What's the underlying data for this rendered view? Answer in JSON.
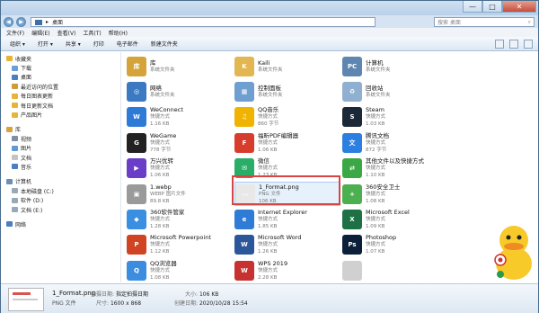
{
  "title": {
    "breadcrumb": "桌面",
    "arrow": "▸"
  },
  "window": {
    "min": "—",
    "max": "□",
    "close": "✕"
  },
  "search": {
    "placeholder": "搜索 桌面"
  },
  "menu": [
    "文件(F)",
    "编辑(E)",
    "查看(V)",
    "工具(T)",
    "帮助(H)"
  ],
  "toolbar": [
    "组织 ▾",
    "打开 ▾",
    "共享 ▾",
    "打印",
    "电子邮件",
    "新建文件夹"
  ],
  "nav": [
    {
      "label": "收藏夹",
      "color": "#e8b339",
      "indent": 6
    },
    {
      "label": "下载",
      "color": "#6aa0d8",
      "indent": 12
    },
    {
      "label": "桌面",
      "color": "#4a7fc0",
      "indent": 12
    },
    {
      "label": "最近访问的位置",
      "color": "#d09c3a",
      "indent": 12
    },
    {
      "label": "每日图表更新",
      "color": "#e8b339",
      "indent": 12
    },
    {
      "label": "每日更新文档",
      "color": "#e8b339",
      "indent": 12
    },
    {
      "label": "产品图片",
      "color": "#e8b339",
      "indent": 12
    },
    {
      "label": "",
      "color": "",
      "indent": 0
    },
    {
      "label": "库",
      "color": "#d6a43a",
      "indent": 6
    },
    {
      "label": "视频",
      "color": "#7c8fa6",
      "indent": 12
    },
    {
      "label": "图片",
      "color": "#5e9bd5",
      "indent": 12
    },
    {
      "label": "文档",
      "color": "#c4c4c4",
      "indent": 12
    },
    {
      "label": "音乐",
      "color": "#4a7fc0",
      "indent": 12
    },
    {
      "label": "",
      "color": "",
      "indent": 0
    },
    {
      "label": "计算机",
      "color": "#6a8fb5",
      "indent": 6
    },
    {
      "label": "本地磁盘 (C:)",
      "color": "#9aa9b8",
      "indent": 12
    },
    {
      "label": "软件 (D:)",
      "color": "#9aa9b8",
      "indent": 12
    },
    {
      "label": "文档 (E:)",
      "color": "#9aa9b8",
      "indent": 12
    },
    {
      "label": "",
      "color": "",
      "indent": 0
    },
    {
      "label": "网络",
      "color": "#4a7fc0",
      "indent": 6
    }
  ],
  "files": [
    {
      "name": "库",
      "sub": "系统文件夹",
      "size": "",
      "color": "#d4a43a",
      "glyph": "库"
    },
    {
      "name": "Kaili",
      "sub": "系统文件夹",
      "size": "",
      "color": "#e2b650",
      "glyph": "K"
    },
    {
      "name": "计算机",
      "sub": "系统文件夹",
      "size": "",
      "color": "#5f86b0",
      "glyph": "PC"
    },
    {
      "name": "网络",
      "sub": "系统文件夹",
      "size": "",
      "color": "#3b7ac2",
      "glyph": "◎"
    },
    {
      "name": "控制面板",
      "sub": "系统文件夹",
      "size": "",
      "color": "#6f9ed0",
      "glyph": "▦"
    },
    {
      "name": "回收站",
      "sub": "系统文件夹",
      "size": "",
      "color": "#8fb0d0",
      "glyph": "♻"
    },
    {
      "name": "WeConnect",
      "sub": "快捷方式",
      "size": "1.16 KB",
      "color": "#2d7bd6",
      "glyph": "W"
    },
    {
      "name": "QQ音乐",
      "sub": "快捷方式",
      "size": "860 字节",
      "color": "#f0b300",
      "glyph": "♫"
    },
    {
      "name": "Steam",
      "sub": "快捷方式",
      "size": "1.03 KB",
      "color": "#1b2838",
      "glyph": "S"
    },
    {
      "name": "WeGame",
      "sub": "快捷方式",
      "size": "778 字节",
      "color": "#222",
      "glyph": "G"
    },
    {
      "name": "福昕PDF编辑器",
      "sub": "快捷方式",
      "size": "1.06 KB",
      "color": "#d83c2c",
      "glyph": "F"
    },
    {
      "name": "腾讯文档",
      "sub": "快捷方式",
      "size": "872 字节",
      "color": "#2b7fe0",
      "glyph": "文"
    },
    {
      "name": "万兴优转",
      "sub": "快捷方式",
      "size": "1.06 KB",
      "color": "#6a3ec6",
      "glyph": "▶"
    },
    {
      "name": "微信",
      "sub": "快捷方式",
      "size": "1.23 KB",
      "color": "#2aae67",
      "glyph": "✉"
    },
    {
      "name": "其他文件以及快捷方式",
      "sub": "快捷方式",
      "size": "1.10 KB",
      "color": "#3aa845",
      "glyph": "⇄"
    },
    {
      "name": "1.webp",
      "sub": "WEBP 图片文件",
      "size": "89.8 KB",
      "color": "#9a9a9a",
      "glyph": "▣"
    },
    {
      "name": "1_Format.png",
      "sub": "PNG 文件",
      "size": "106 KB",
      "color": "#e8e8e8",
      "glyph": "▭"
    },
    {
      "name": "360安全卫士",
      "sub": "快捷方式",
      "size": "1.08 KB",
      "color": "#4caf50",
      "glyph": "+"
    },
    {
      "name": "360软件管家",
      "sub": "快捷方式",
      "size": "1.28 KB",
      "color": "#3b8fe0",
      "glyph": "◆"
    },
    {
      "name": "Internet Explorer",
      "sub": "快捷方式",
      "size": "1.85 KB",
      "color": "#2e7cd6",
      "glyph": "e"
    },
    {
      "name": "Microsoft Excel",
      "sub": "快捷方式",
      "size": "1.09 KB",
      "color": "#1e7145",
      "glyph": "X"
    },
    {
      "name": "Microsoft Powerpoint",
      "sub": "快捷方式",
      "size": "1.12 KB",
      "color": "#d04423",
      "glyph": "P"
    },
    {
      "name": "Microsoft Word",
      "sub": "快捷方式",
      "size": "1.26 KB",
      "color": "#2b579a",
      "glyph": "W"
    },
    {
      "name": "Photoshop",
      "sub": "快捷方式",
      "size": "1.07 KB",
      "color": "#0b1f3a",
      "glyph": "Ps"
    },
    {
      "name": "QQ浏览器",
      "sub": "快捷方式",
      "size": "1.08 KB",
      "color": "#3c8de0",
      "glyph": "Q"
    },
    {
      "name": "WPS 2019",
      "sub": "快捷方式",
      "size": "2.28 KB",
      "color": "#c7312f",
      "glyph": "W"
    },
    {
      "name": "",
      "sub": "",
      "size": "",
      "color": "#d0d0d0",
      "glyph": ""
    },
    {
      "name": "",
      "sub": "",
      "size": "",
      "color": "#c7312f",
      "glyph": "✦"
    },
    {
      "name": "",
      "sub": "",
      "size": "",
      "color": "#c7312f",
      "glyph": "✎"
    },
    {
      "name": "",
      "sub": "",
      "size": "",
      "color": "#c7312f",
      "glyph": "▤"
    }
  ],
  "details": {
    "name": "1_Format.png",
    "type": "PNG 文件",
    "taken_label": "拍摄日期:",
    "taken_value": "指定拍摄日期",
    "dims_label": "尺寸:",
    "dims_value": "1600 x 868",
    "size_label": "大小:",
    "size_value": "106 KB",
    "created_label": "创建日期:",
    "created_value": "2020/10/28 15:54"
  }
}
